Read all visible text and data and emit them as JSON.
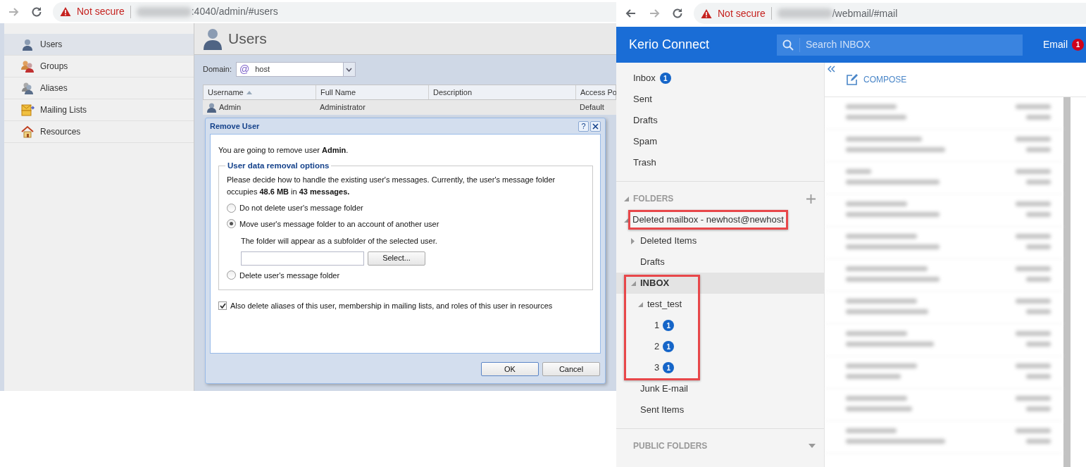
{
  "admin_browser": {
    "security": "Not secure",
    "url": ":4040/admin/#users"
  },
  "admin": {
    "sidebar": [
      {
        "label": "Users",
        "kind": "user",
        "selected": true
      },
      {
        "label": "Groups",
        "kind": "group",
        "selected": false
      },
      {
        "label": "Aliases",
        "kind": "alias",
        "selected": false
      },
      {
        "label": "Mailing Lists",
        "kind": "list",
        "selected": false
      },
      {
        "label": "Resources",
        "kind": "resource",
        "selected": false
      }
    ],
    "page_title": "Users",
    "domain": {
      "label": "Domain:",
      "symbol": "@",
      "value": "host"
    },
    "table": {
      "columns": [
        {
          "label": "Username",
          "sorted": true
        },
        {
          "label": "Full Name",
          "sorted": false
        },
        {
          "label": "Description",
          "sorted": false
        },
        {
          "label": "Access Po",
          "sorted": false
        }
      ],
      "rows": [
        {
          "username": "Admin",
          "full_name": "Administrator",
          "access_policy": "Default"
        }
      ]
    },
    "dialog": {
      "title": "Remove User",
      "help": "?",
      "intro": "You are going to remove user **Admin**.",
      "group_title": "User data removal options",
      "message": "Please decide how to handle the existing user's messages. Currently, the user's message folder occupies **48.6 MB** in **43 messages.**",
      "options": [
        {
          "label": "Do not delete user's message folder",
          "selected": false
        },
        {
          "label": "Move user's message folder to an account of another user",
          "selected": true,
          "hint": "The folder will appear as a subfolder of the selected user.",
          "button": "Select..."
        },
        {
          "label": "Delete user's message folder",
          "selected": false
        }
      ],
      "also_delete": {
        "label": "Also delete aliases of this user, membership in mailing lists, and roles of this user in resources",
        "checked": true
      },
      "buttons": [
        {
          "label": "OK",
          "default": true
        },
        {
          "label": "Cancel",
          "default": false
        }
      ]
    }
  },
  "webmail_browser": {
    "security": "Not secure",
    "url": "/webmail/#mail"
  },
  "webmail": {
    "app_title": "Kerio Connect",
    "search_placeholder": "Search INBOX",
    "nav": {
      "label": "Email",
      "badge": "1"
    },
    "favorites": [
      {
        "label": "Inbox",
        "badge": "1"
      },
      {
        "label": "Sent"
      },
      {
        "label": "Drafts"
      },
      {
        "label": "Spam"
      },
      {
        "label": "Trash"
      }
    ],
    "folders_title": "FOLDERS",
    "folders_expanded": true,
    "folders": [
      {
        "label": "Deleted mailbox - newhost@newhost",
        "kind": "mailbox",
        "expanded": true,
        "selected": false,
        "highlighted": true,
        "children": [
          {
            "label": "Deleted Items",
            "kind": "folder",
            "expanded": false,
            "selected": false,
            "highlighted": false
          },
          {
            "label": "Drafts",
            "kind": "folder",
            "selected": false,
            "highlighted": false
          },
          {
            "label": "INBOX",
            "kind": "folder",
            "expanded": true,
            "selected": true,
            "highlighted": true,
            "children": [
              {
                "label": "test_test",
                "kind": "folder",
                "expanded": true,
                "selected": false,
                "highlighted": false,
                "children": [
                  {
                    "label": "1",
                    "kind": "folder",
                    "selected": false,
                    "highlighted": false,
                    "badge": "1"
                  },
                  {
                    "label": "2",
                    "kind": "folder",
                    "selected": false,
                    "highlighted": false,
                    "badge": "1"
                  },
                  {
                    "label": "3",
                    "kind": "folder",
                    "selected": false,
                    "highlighted": false,
                    "badge": "1"
                  }
                ]
              }
            ]
          },
          {
            "label": "Junk E-mail",
            "kind": "folder",
            "selected": false,
            "highlighted": false
          },
          {
            "label": "Sent Items",
            "kind": "folder",
            "selected": false,
            "highlighted": false
          }
        ]
      }
    ],
    "public_title": "PUBLIC FOLDERS",
    "public_expanded": false,
    "compose": "COMPOSE"
  }
}
